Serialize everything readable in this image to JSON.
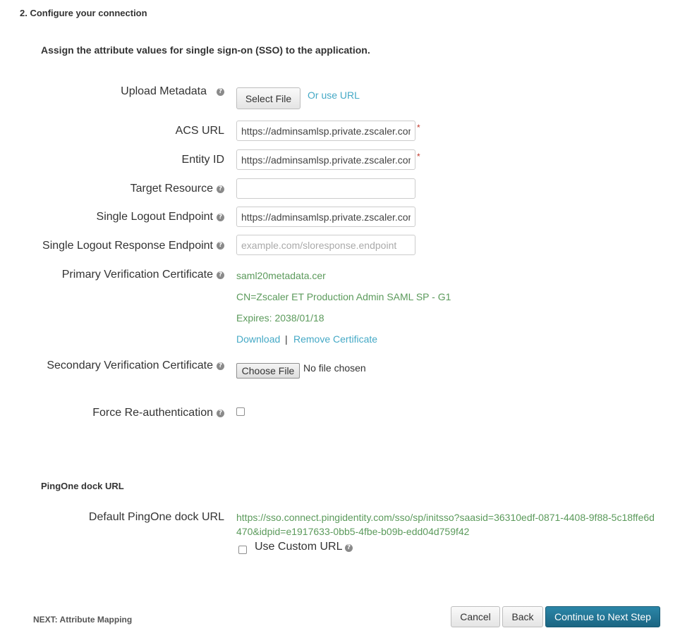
{
  "section": {
    "title": "2. Configure your connection",
    "subtitle": "Assign the attribute values for single sign-on (SSO) to the application."
  },
  "form": {
    "upload_metadata": {
      "label": "Upload Metadata",
      "button": "Select File",
      "link": "Or use URL"
    },
    "acs_url": {
      "label": "ACS URL",
      "value": "https://adminsamlsp.private.zscaler.com",
      "required": "*"
    },
    "entity_id": {
      "label": "Entity ID",
      "value": "https://adminsamlsp.private.zscaler.com",
      "required": "*"
    },
    "target_resource": {
      "label": "Target Resource",
      "value": ""
    },
    "single_logout_endpoint": {
      "label": "Single Logout Endpoint",
      "value": "https://adminsamlsp.private.zscaler.com"
    },
    "single_logout_response_endpoint": {
      "label": "Single Logout Response Endpoint",
      "placeholder": "example.com/sloresponse.endpoint"
    },
    "primary_cert": {
      "label": "Primary Verification Certificate",
      "filename": "saml20metadata.cer",
      "cn": "CN=Zscaler ET Production Admin SAML SP - G1",
      "expires": "Expires: 2038/01/18",
      "download": "Download",
      "separator": "|",
      "remove": "Remove Certificate"
    },
    "secondary_cert": {
      "label": "Secondary Verification Certificate",
      "button": "Choose File",
      "status": "No file chosen"
    },
    "force_reauth": {
      "label": "Force Re-authentication"
    }
  },
  "dock": {
    "title": "PingOne dock URL",
    "label": "Default PingOne dock URL",
    "url": "https://sso.connect.pingidentity.com/sso/sp/initsso?saasid=36310edf-0871-4408-9f88-5c18ffe6d470&idpid=e1917633-0bb5-4fbe-b09b-edd04d759f42",
    "custom_label": "Use Custom URL"
  },
  "footer": {
    "next": "NEXT: Attribute Mapping",
    "cancel": "Cancel",
    "back": "Back",
    "continue": "Continue to Next Step"
  },
  "icons": {
    "help": "question-circle-icon"
  },
  "colors": {
    "link": "#45a9c6",
    "value_green": "#5b9a5b",
    "primary": "#1f6f8e",
    "required": "#c0392b"
  }
}
